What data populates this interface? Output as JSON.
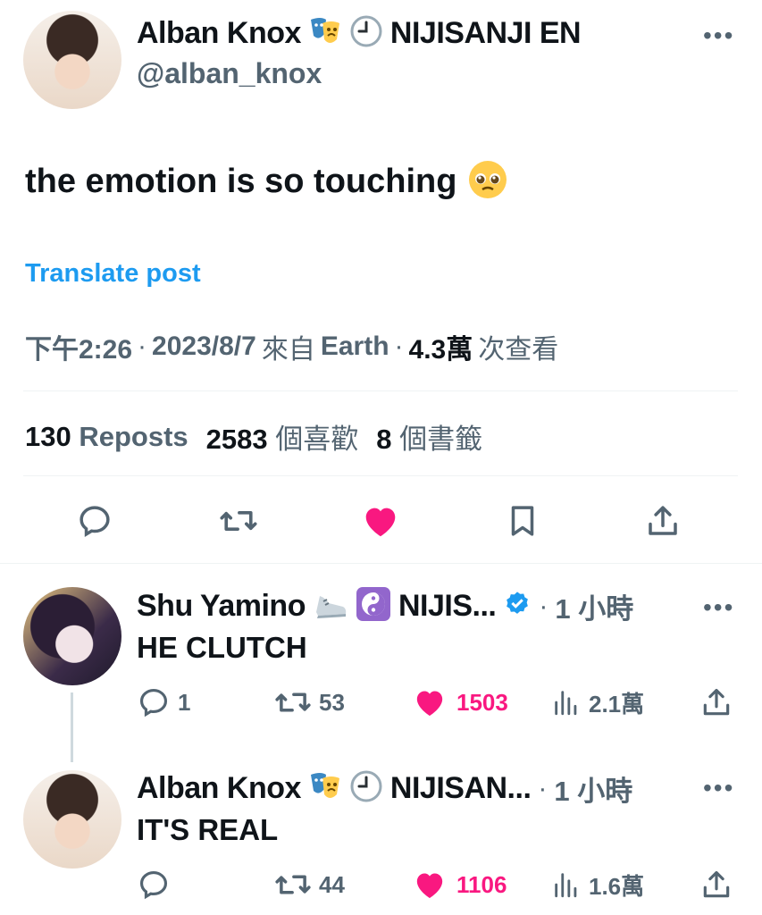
{
  "main_post": {
    "author_name": "Alban Knox",
    "author_affiliation": "NIJISANJI EN",
    "author_handle": "@alban_knox",
    "text": "the emotion is so touching",
    "translate_label": "Translate post",
    "meta": {
      "time": "下午2:26",
      "date": "2023/8/7",
      "source_prefix": "來自",
      "source": "Earth",
      "views_value": "4.3萬",
      "views_label": "次查看"
    },
    "stats": {
      "reposts_value": "130",
      "reposts_label": "Reposts",
      "likes_value": "2583",
      "likes_label": "個喜歡",
      "bookmarks_value": "8",
      "bookmarks_label": "個書籤"
    }
  },
  "replies": [
    {
      "author_name": "Shu Yamino",
      "author_affiliation": "NIJIS...",
      "verified": true,
      "time": "1 小時",
      "text": "HE CLUTCH",
      "replies_count": "1",
      "reposts_count": "53",
      "likes_count": "1503",
      "views_count": "2.1萬"
    },
    {
      "author_name": "Alban Knox",
      "author_affiliation": "NIJISAN...",
      "verified": false,
      "time": "1 小時",
      "text": "IT'S REAL",
      "replies_count": "",
      "reposts_count": "44",
      "likes_count": "1106",
      "views_count": "1.6萬"
    }
  ],
  "colors": {
    "accent": "#1d9bf0",
    "like": "#f91880",
    "secondary_text": "#536471",
    "divider": "#eff3f4"
  },
  "icons": [
    "more-icon",
    "theater-masks-icon",
    "clock-icon",
    "reply-icon",
    "repost-icon",
    "like-icon",
    "bookmark-icon",
    "share-icon",
    "views-icon",
    "verified-icon",
    "sneaker-icon",
    "yin-yang-icon",
    "pleading-face-icon"
  ]
}
